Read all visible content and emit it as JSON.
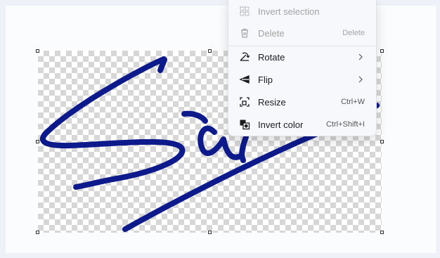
{
  "menu": {
    "items": [
      {
        "label": "Invert selection",
        "shortcut": "",
        "icon": "invert-selection-icon",
        "disabled": true
      },
      {
        "label": "Delete",
        "shortcut": "Delete",
        "icon": "trash-icon",
        "disabled": true
      },
      {
        "label": "Rotate",
        "shortcut": "",
        "icon": "rotate-icon",
        "disabled": false,
        "submenu": true
      },
      {
        "label": "Flip",
        "shortcut": "",
        "icon": "flip-icon",
        "disabled": false,
        "submenu": true
      },
      {
        "label": "Resize",
        "shortcut": "Ctrl+W",
        "icon": "resize-icon",
        "disabled": false
      },
      {
        "label": "Invert color",
        "shortcut": "Ctrl+Shift+I",
        "icon": "invert-color-icon",
        "disabled": false
      }
    ]
  },
  "colors": {
    "signature_stroke": "#0d1a8c",
    "menu_background": "#f7f8fb",
    "page_background": "#eef1f7"
  }
}
